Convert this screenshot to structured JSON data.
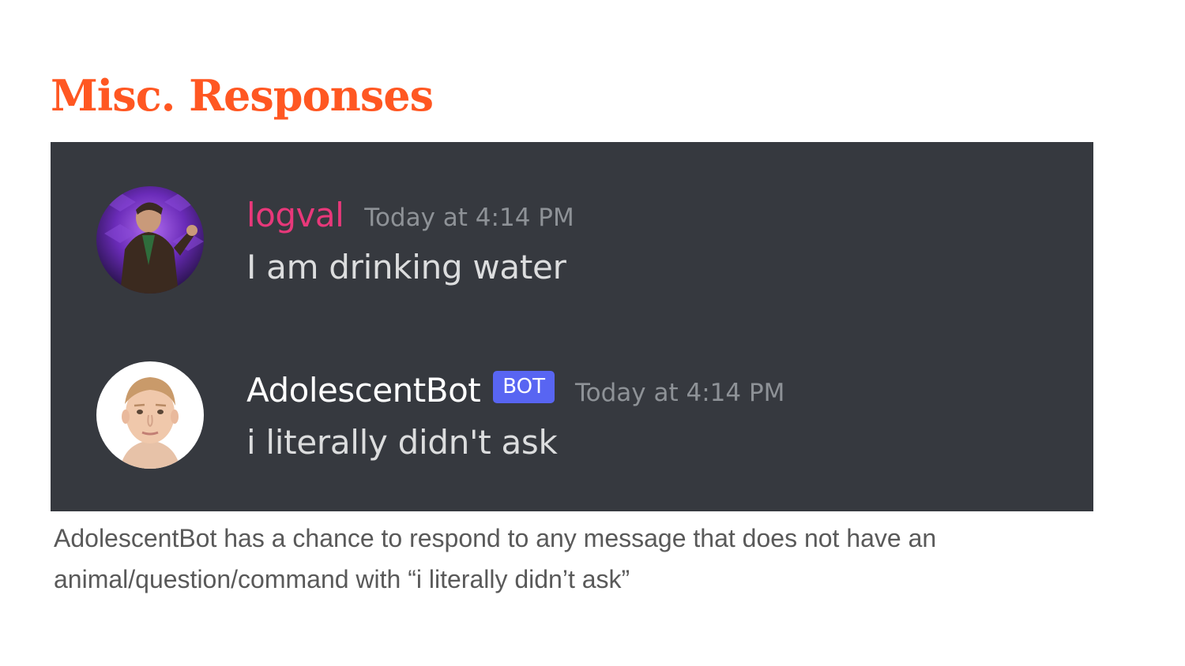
{
  "slide": {
    "title": "Misc. Responses",
    "caption": "AdolescentBot has a chance to respond to any message that does not have an animal/question/command with “i literally didn’t ask”"
  },
  "colors": {
    "title": "#ff5722",
    "chat_background": "#36393f",
    "logval_name": "#e8387a",
    "bot_tag": "#5865f2",
    "timestamp": "#8e9297",
    "message_text": "#dcddde"
  },
  "messages": [
    {
      "username": "logval",
      "timestamp": "Today at 4:14 PM",
      "text": "I am drinking water",
      "avatar": "user-avatar-icon"
    },
    {
      "username": "AdolescentBot",
      "tag": "BOT",
      "timestamp": "Today at 4:14 PM",
      "text": "i literally didn't ask",
      "avatar": "bot-avatar-icon"
    }
  ]
}
